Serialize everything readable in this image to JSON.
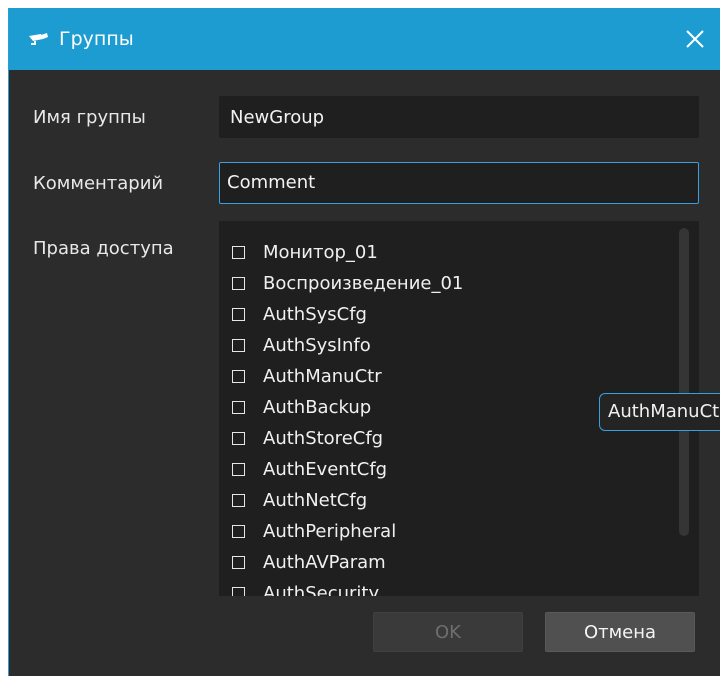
{
  "window": {
    "title": "Группы",
    "icon": "camera-icon",
    "close_icon": "close-icon"
  },
  "form": {
    "group_name_label": "Имя группы",
    "group_name_value": "NewGroup",
    "comment_label": "Комментарий",
    "comment_value": "Comment",
    "permissions_label": "Права доступа"
  },
  "permissions": [
    {
      "label": "Монитор_01",
      "checked": false
    },
    {
      "label": "Воспроизведение_01",
      "checked": false
    },
    {
      "label": "AuthSysCfg",
      "checked": false
    },
    {
      "label": "AuthSysInfo",
      "checked": false
    },
    {
      "label": "AuthManuCtr",
      "checked": false
    },
    {
      "label": "AuthBackup",
      "checked": false
    },
    {
      "label": "AuthStoreCfg",
      "checked": false
    },
    {
      "label": "AuthEventCfg",
      "checked": false
    },
    {
      "label": "AuthNetCfg",
      "checked": false
    },
    {
      "label": "AuthPeripheral",
      "checked": false
    },
    {
      "label": "AuthAVParam",
      "checked": false
    },
    {
      "label": "AuthSecurity",
      "checked": false
    }
  ],
  "tooltip": {
    "text": "AuthManuCtr"
  },
  "buttons": {
    "ok_label": "OK",
    "cancel_label": "Отмена"
  },
  "colors": {
    "titlebar": "#1c9cd1",
    "background": "#2c2c2c",
    "field_background": "#1f1f1f",
    "focus_accent": "#3a9fe0"
  }
}
